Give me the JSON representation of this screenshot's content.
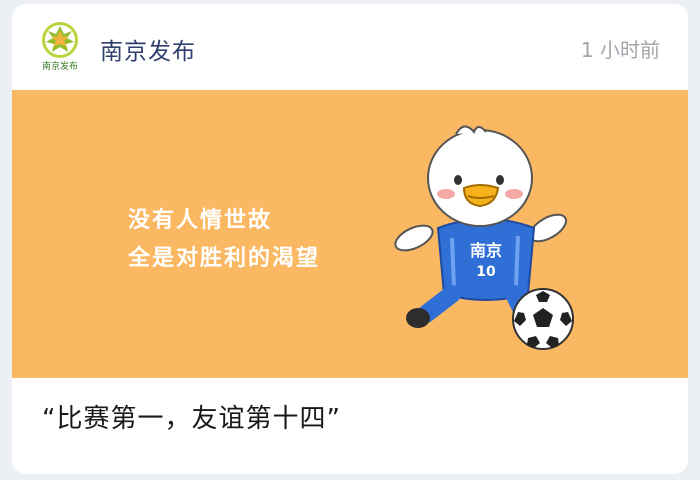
{
  "account": {
    "name": "南京发布",
    "logo_text": "南京发布",
    "time": "1 小时前"
  },
  "cover": {
    "line1": "没有人情世故",
    "line2": "全是对胜利的渴望",
    "jersey_text": "南京",
    "jersey_number": "10",
    "background_color": "#fbb862"
  },
  "article": {
    "title": "“比赛第一，友谊第十四”"
  }
}
